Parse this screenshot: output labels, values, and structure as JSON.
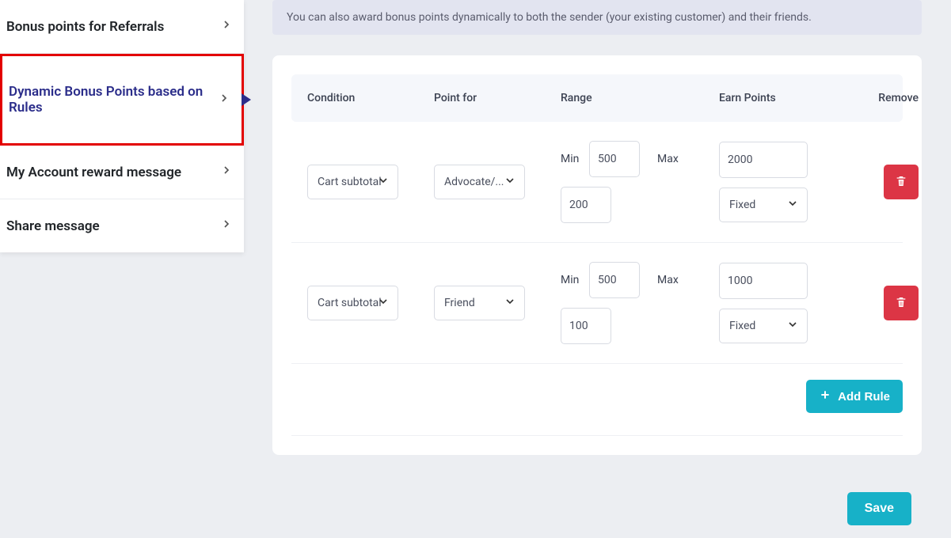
{
  "sidebar": {
    "items": [
      {
        "label": "Bonus points for Referrals"
      },
      {
        "label": "Dynamic Bonus Points based on Rules"
      },
      {
        "label": "My Account reward message"
      },
      {
        "label": "Share message"
      }
    ]
  },
  "banner": {
    "text": "You can also award bonus points dynamically to both the sender (your existing customer) and their friends."
  },
  "table": {
    "headers": {
      "condition": "Condition",
      "point_for": "Point for",
      "range": "Range",
      "earn_points": "Earn Points",
      "remove": "Remove"
    },
    "range_labels": {
      "min": "Min",
      "max": "Max"
    },
    "rules": [
      {
        "condition": "Cart subtotal",
        "point_for": "Advocate/...",
        "min": "500",
        "extra": "200",
        "earn_value": "2000",
        "earn_type": "Fixed"
      },
      {
        "condition": "Cart subtotal",
        "point_for": "Friend",
        "min": "500",
        "extra": "100",
        "earn_value": "1000",
        "earn_type": "Fixed"
      }
    ]
  },
  "buttons": {
    "add_rule": "Add Rule",
    "save": "Save"
  }
}
